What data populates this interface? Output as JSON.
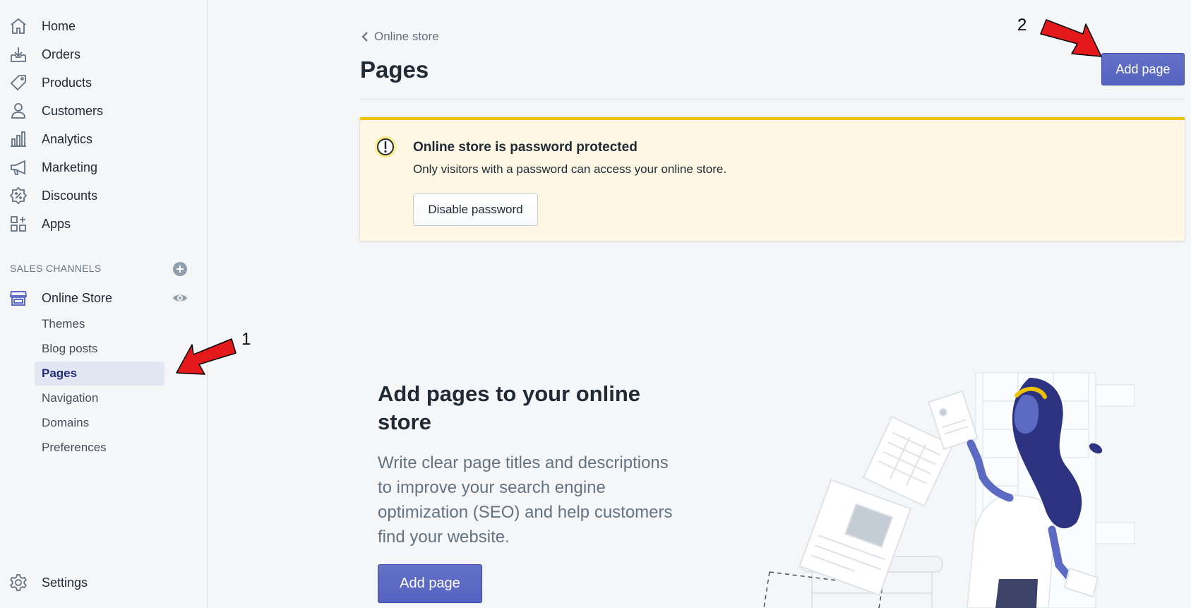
{
  "sidebar": {
    "nav": [
      {
        "label": "Home",
        "icon": "home-icon"
      },
      {
        "label": "Orders",
        "icon": "orders-icon"
      },
      {
        "label": "Products",
        "icon": "products-tag-icon"
      },
      {
        "label": "Customers",
        "icon": "customers-icon"
      },
      {
        "label": "Analytics",
        "icon": "analytics-icon"
      },
      {
        "label": "Marketing",
        "icon": "marketing-megaphone-icon"
      },
      {
        "label": "Discounts",
        "icon": "discounts-icon"
      },
      {
        "label": "Apps",
        "icon": "apps-icon"
      }
    ],
    "sales_channels_label": "SALES CHANNELS",
    "online_store_label": "Online Store",
    "sub_items": [
      "Themes",
      "Blog posts",
      "Pages",
      "Navigation",
      "Domains",
      "Preferences"
    ],
    "active_sub_item": "Pages",
    "settings_label": "Settings"
  },
  "main": {
    "breadcrumb": "Online store",
    "title": "Pages",
    "add_page_label": "Add page",
    "banner": {
      "title": "Online store is password protected",
      "text": "Only visitors with a password can access your online store.",
      "button": "Disable password"
    },
    "empty_state": {
      "heading": "Add pages to your online store",
      "text": "Write clear page titles and descriptions to improve your search engine optimization (SEO) and help customers find your website.",
      "button": "Add page"
    }
  },
  "annotations": {
    "one": "1",
    "two": "2"
  },
  "colors": {
    "accent": "#5c6ac4",
    "active_bg": "#e3e6f3",
    "banner_bg": "#fdf7e3",
    "banner_border": "#eec200",
    "arrow": "#e3191c"
  }
}
